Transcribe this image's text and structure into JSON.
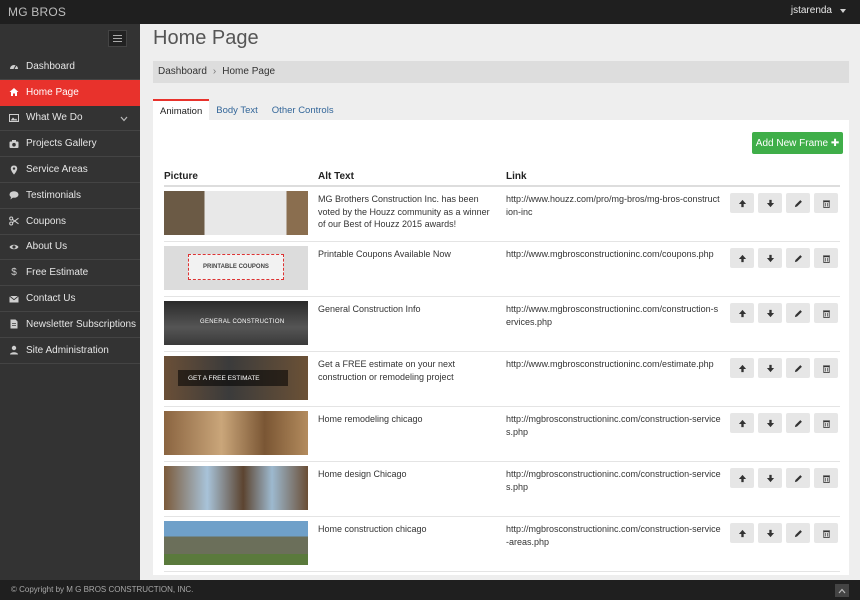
{
  "app": {
    "brand": "MG BROS",
    "user": "jstarenda"
  },
  "sidebar": {
    "items": [
      {
        "label": "Dashboard",
        "icon": "dashboard-icon",
        "active": false
      },
      {
        "label": "Home Page",
        "icon": "home-icon",
        "active": true
      },
      {
        "label": "What We Do",
        "icon": "image-icon",
        "active": false,
        "expandable": true
      },
      {
        "label": "Projects Gallery",
        "icon": "camera-icon",
        "active": false
      },
      {
        "label": "Service Areas",
        "icon": "map-pin-icon",
        "active": false
      },
      {
        "label": "Testimonials",
        "icon": "comment-icon",
        "active": false
      },
      {
        "label": "Coupons",
        "icon": "scissors-icon",
        "active": false
      },
      {
        "label": "About Us",
        "icon": "eye-icon",
        "active": false
      },
      {
        "label": "Free Estimate",
        "icon": "dollar-icon",
        "active": false
      },
      {
        "label": "Contact Us",
        "icon": "envelope-icon",
        "active": false
      },
      {
        "label": "Newsletter Subscriptions",
        "icon": "document-icon",
        "active": false
      },
      {
        "label": "Site Administration",
        "icon": "user-icon",
        "active": false
      }
    ]
  },
  "page": {
    "title": "Home Page",
    "breadcrumb": [
      "Dashboard",
      "Home Page"
    ],
    "tabs": [
      "Animation",
      "Body Text",
      "Other Controls"
    ],
    "add_button": "Add New Frame ✚"
  },
  "table": {
    "headers": [
      "Picture",
      "Alt Text",
      "Link"
    ],
    "rows": [
      {
        "thumb_text": "",
        "alt": "MG Brothers Construction Inc. has been voted by the Houzz community as a winner of our Best of Houzz 2015 awards!",
        "link": "http://www.houzz.com/pro/mg-bros/mg-bros-construction-inc"
      },
      {
        "thumb_text": "PRINTABLE COUPONS",
        "alt": "Printable Coupons Available Now",
        "link": "http://www.mgbrosconstructioninc.com/coupons.php"
      },
      {
        "thumb_text": "GENERAL CONSTRUCTION",
        "alt": "General Construction Info",
        "link": "http://www.mgbrosconstructioninc.com/construction-services.php"
      },
      {
        "thumb_text": "GET A FREE ESTIMATE",
        "alt": "Get a FREE estimate on your next construction or remodeling project",
        "link": "http://www.mgbrosconstructioninc.com/estimate.php"
      },
      {
        "thumb_text": "",
        "alt": "Home remodeling chicago",
        "link": "http://mgbrosconstructioninc.com/construction-services.php"
      },
      {
        "thumb_text": "",
        "alt": "Home design Chicago",
        "link": "http://mgbrosconstructioninc.com/construction-services.php"
      },
      {
        "thumb_text": "",
        "alt": "Home construction chicago",
        "link": "http://mgbrosconstructioninc.com/construction-service-areas.php"
      }
    ]
  },
  "footer": {
    "copyright": "© Copyright by M G BROS CONSTRUCTION, INC."
  }
}
